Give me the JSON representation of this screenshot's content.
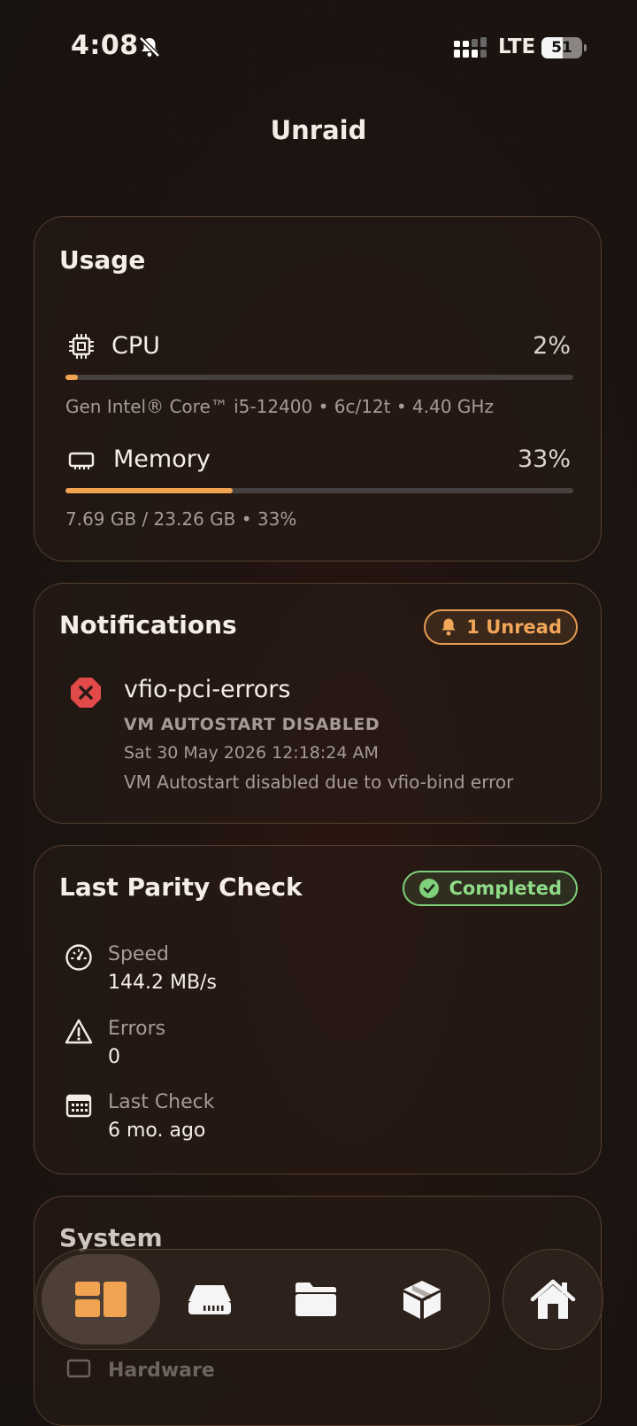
{
  "status_bar": {
    "time": "4:08",
    "network": "LTE",
    "battery": "51"
  },
  "app_title": "Unraid",
  "usage": {
    "title": "Usage",
    "cpu": {
      "label": "CPU",
      "value": "2%",
      "fraction": 0.02,
      "detail": "Gen Intel® Core™ i5-12400 • 6c/12t • 4.40 GHz"
    },
    "memory": {
      "label": "Memory",
      "value": "33%",
      "fraction": 0.33,
      "detail": "7.69 GB / 23.26 GB • 33%"
    }
  },
  "notifications": {
    "title": "Notifications",
    "badge": "1 Unread",
    "item": {
      "name": "vfio-pci-errors",
      "subject": "VM AUTOSTART DISABLED",
      "timestamp": "Sat 30 May 2026 12:18:24 AM",
      "message": "VM Autostart disabled due to vfio-bind error"
    }
  },
  "parity": {
    "title": "Last Parity Check",
    "status": "Completed",
    "stats": [
      {
        "label": "Speed",
        "value": "144.2 MB/s"
      },
      {
        "label": "Errors",
        "value": "0"
      },
      {
        "label": "Last Check",
        "value": "6 mo. ago"
      }
    ]
  },
  "system": {
    "title": "System",
    "row_label": "Hardware"
  },
  "tabs": [
    "dashboard-icon",
    "storage-icon",
    "folder-icon",
    "box-icon",
    "home-icon"
  ],
  "colors": {
    "accent": "#f0a452",
    "success": "#7fd07a",
    "error": "#e24a4a"
  }
}
